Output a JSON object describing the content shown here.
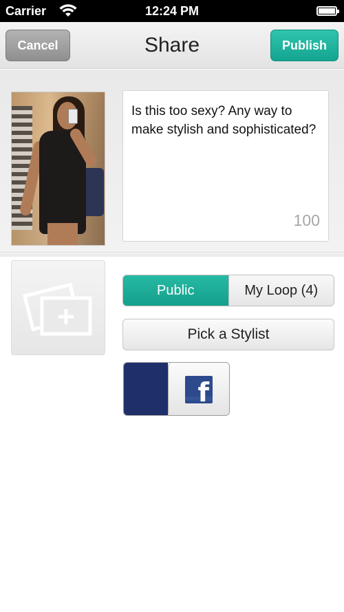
{
  "status_bar": {
    "carrier": "Carrier",
    "time": "12:24 PM"
  },
  "nav": {
    "title": "Share",
    "cancel_label": "Cancel",
    "publish_label": "Publish"
  },
  "compose": {
    "caption": "Is this too sexy? Any way to make stylish and sophisticated?",
    "char_count": "100"
  },
  "audience": {
    "options": [
      "Public",
      "My Loop (4)"
    ],
    "selected": "Public"
  },
  "pick_stylist_label": "Pick a Stylist",
  "facebook_share": {
    "icon": "facebook-icon",
    "state": "on"
  },
  "colors": {
    "accent": "#1aab96",
    "facebook": "#1f2f6a"
  }
}
